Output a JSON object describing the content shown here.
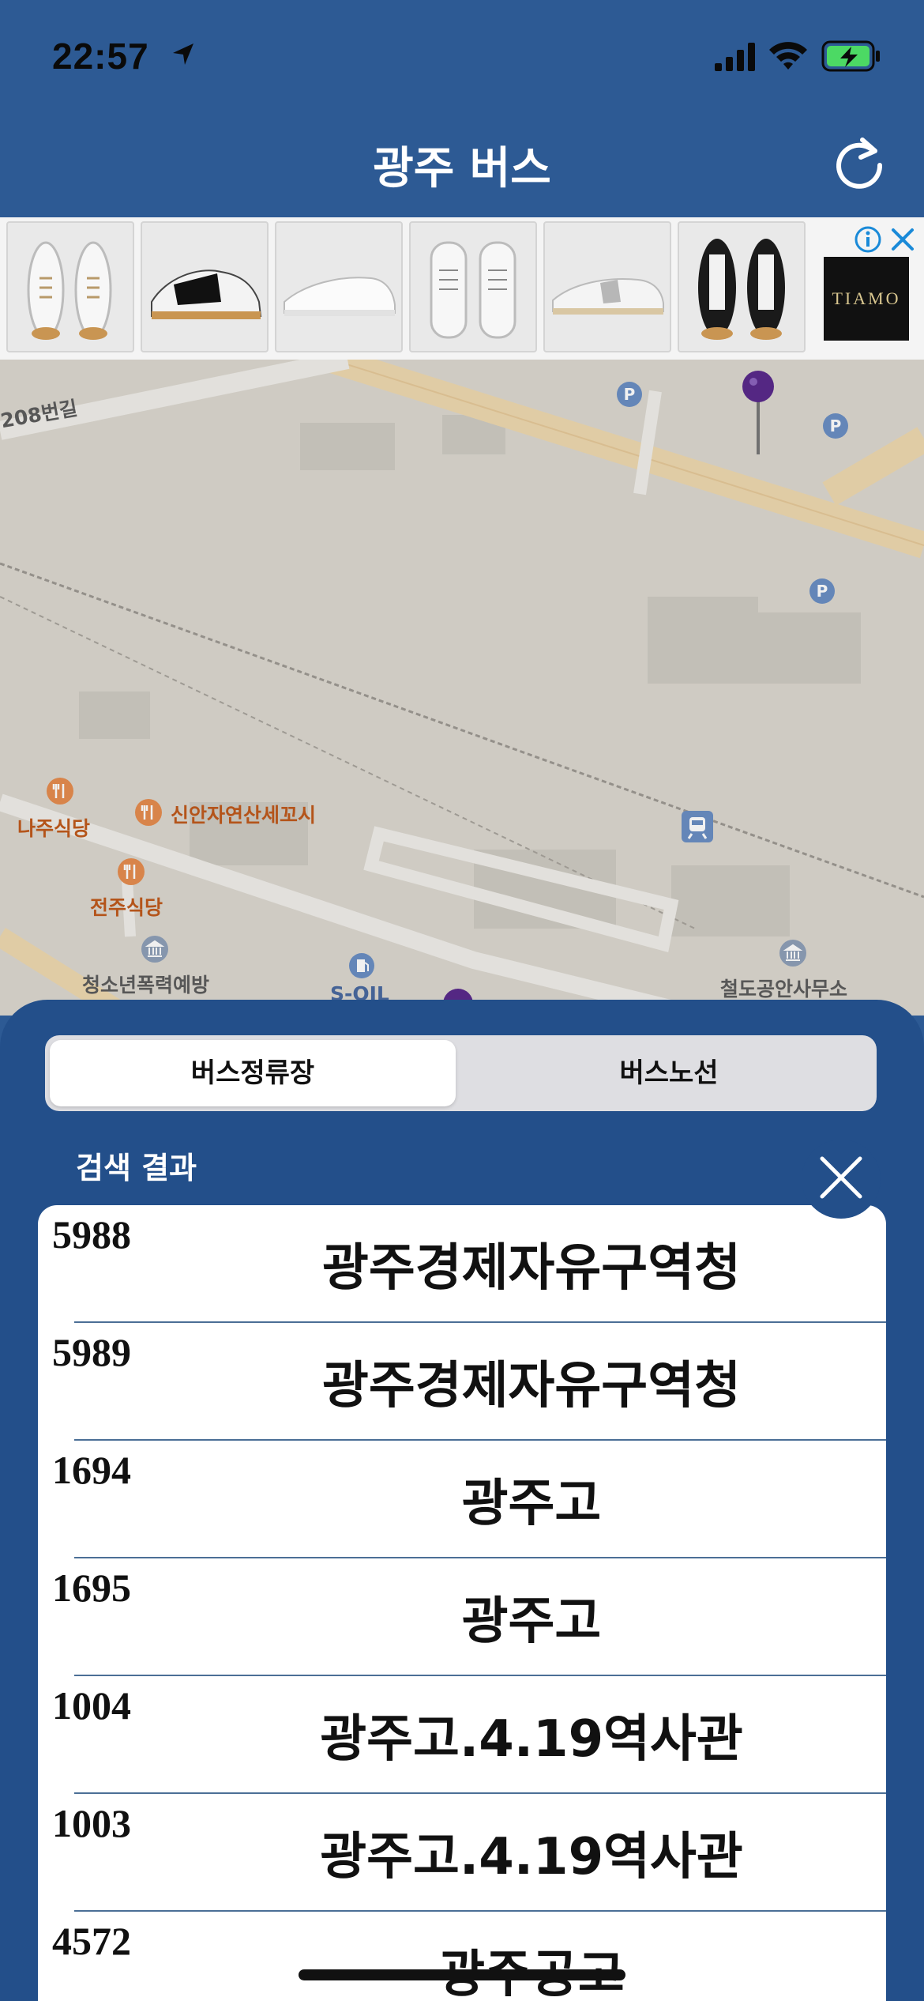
{
  "status_bar": {
    "time": "22:57",
    "icons": [
      "location-arrow-icon",
      "cellular-signal-icon",
      "wifi-icon",
      "battery-charging-icon"
    ],
    "battery_color": "#4cd964"
  },
  "nav": {
    "title": "광주 버스",
    "refresh_icon": "refresh-icon"
  },
  "ad": {
    "brand": "TIAMO",
    "product_count": 6,
    "icons": [
      "info-icon",
      "close-icon"
    ]
  },
  "map": {
    "labels": {
      "street": "208번길",
      "restaurant_1": "나주식당",
      "restaurant_2": "신안자연산세꼬시",
      "restaurant_3": "전주식당",
      "facility_1": "청소년폭력예방",
      "gas_station": "S-OIL",
      "office": "철도공안사무소"
    },
    "icons": [
      "parking-icon",
      "restaurant-icon",
      "train-station-icon",
      "government-building-icon",
      "gas-station-icon",
      "location-pin-icon"
    ]
  },
  "sheet": {
    "tabs": [
      {
        "label": "버스정류장",
        "selected": true
      },
      {
        "label": "버스노선",
        "selected": false
      }
    ],
    "results_label": "검색 결과",
    "results": [
      {
        "id": "5988",
        "name": "광주경제자유구역청"
      },
      {
        "id": "5989",
        "name": "광주경제자유구역청"
      },
      {
        "id": "1694",
        "name": "광주고"
      },
      {
        "id": "1695",
        "name": "광주고"
      },
      {
        "id": "1004",
        "name": "광주고.4.19역사관"
      },
      {
        "id": "1003",
        "name": "광주고.4.19역사관"
      },
      {
        "id": "4572",
        "name": "광주공고"
      }
    ]
  },
  "colors": {
    "header_blue": "#2d5a94",
    "sheet_blue": "#234f8a",
    "map_bg": "#dcd8d0",
    "pin_purple": "#5a2a8c"
  }
}
